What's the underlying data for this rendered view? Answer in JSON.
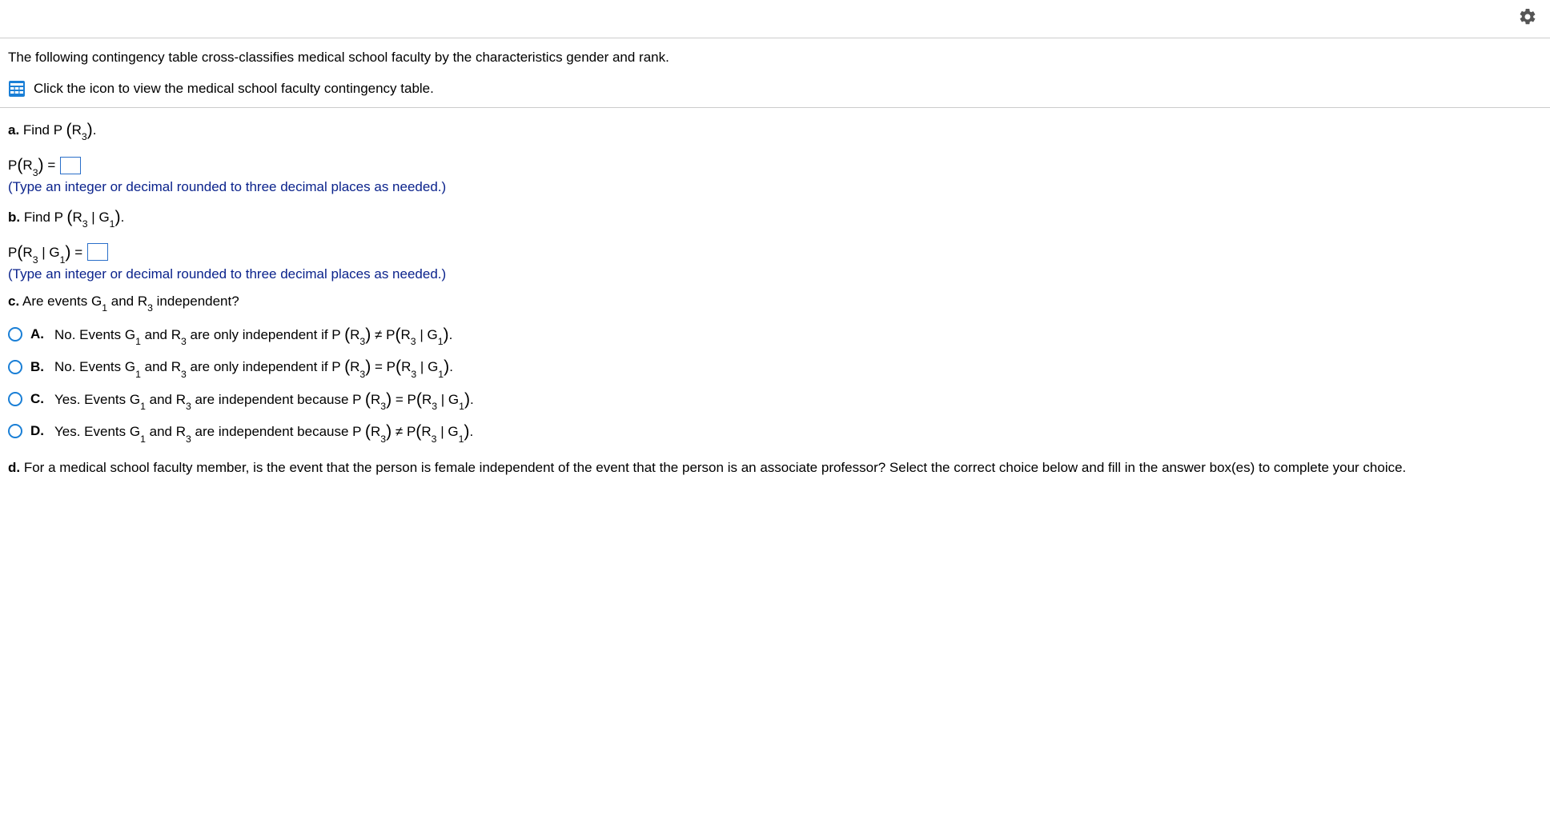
{
  "intro": {
    "text": "The following contingency table cross-classifies medical school faculty by the characteristics gender and rank.",
    "table_link": "Click the icon to view the medical school faculty contingency table."
  },
  "parts": {
    "a": {
      "label": "a.",
      "text": "Find P",
      "r_sub": "3",
      "answer_prefix": "P",
      "hint": "(Type an integer or decimal rounded to three decimal places as needed.)"
    },
    "b": {
      "label": "b.",
      "text": "Find P",
      "r_sub": "3",
      "g_sub": "1",
      "hint": "(Type an integer or decimal rounded to three decimal places as needed.)"
    },
    "c": {
      "label": "c.",
      "text": "Are events G",
      "g_sub": "1",
      "text2": " and R",
      "r_sub": "3",
      "text3": " independent?"
    },
    "d": {
      "label": "d.",
      "text": "For a medical school faculty member, is the event that the person is female independent of the event that the person is an associate professor? Select the correct choice below and fill in the answer box(es) to complete your choice."
    }
  },
  "options": {
    "A": {
      "letter": "A.",
      "text1": "No. Events G",
      "g_sub": "1",
      "text2": " and R",
      "r_sub": "3",
      "text3": " are only independent if P",
      "op": " ≠ P"
    },
    "B": {
      "letter": "B.",
      "text1": "No. Events G",
      "g_sub": "1",
      "text2": " and R",
      "r_sub": "3",
      "text3": " are only independent if P",
      "op": " = P"
    },
    "C": {
      "letter": "C.",
      "text1": "Yes. Events G",
      "g_sub": "1",
      "text2": " and R",
      "r_sub": "3",
      "text3": " are independent because P",
      "op": " = P"
    },
    "D": {
      "letter": "D.",
      "text1": "Yes. Events G",
      "g_sub": "1",
      "text2": " and R",
      "r_sub": "3",
      "text3": " are independent because P",
      "op": " ≠ P"
    }
  }
}
